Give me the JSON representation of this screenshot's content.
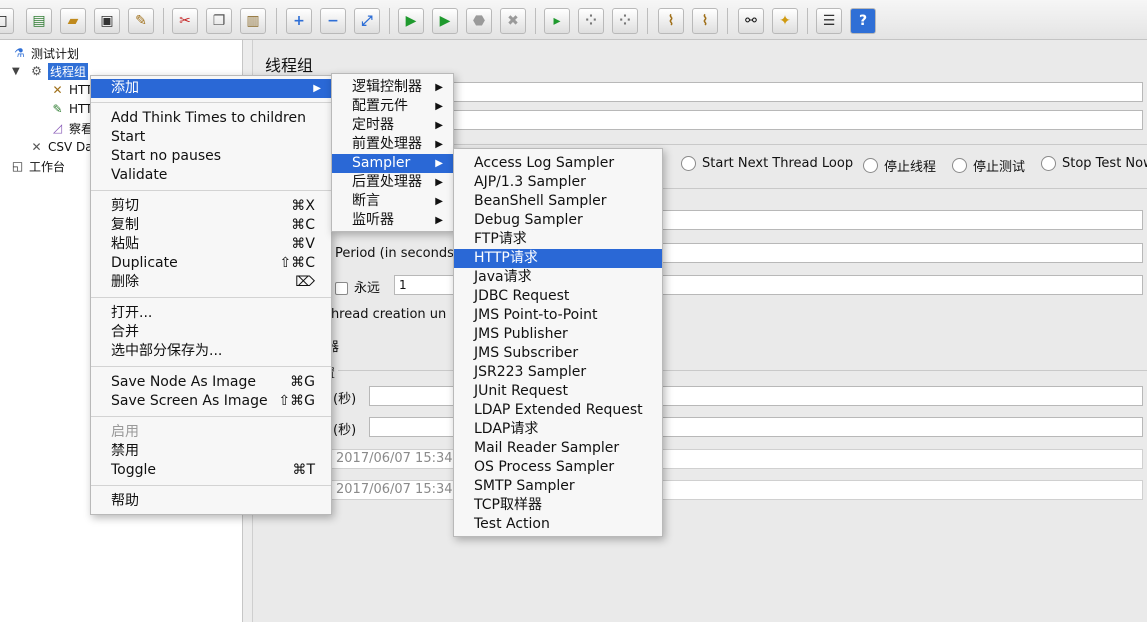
{
  "toolbar": {
    "buttons": [
      "new-icon",
      "templates-icon",
      "open-icon",
      "save-icon",
      "edit-icon",
      "cut-icon",
      "copy-icon",
      "paste-icon",
      "expand-icon",
      "collapse-icon",
      "toggle-icon",
      "start-icon",
      "start-no-pause-icon",
      "stop-icon",
      "shutdown-icon",
      "remote-start-icon",
      "remote-stop-icon",
      "remote-shutdown-icon",
      "clear-icon",
      "clear-all-icon",
      "search-icon",
      "reset-search-icon",
      "function-helper-icon",
      "help-icon"
    ]
  },
  "tree": {
    "items": [
      {
        "label": "测试计划"
      },
      {
        "label": "线程组"
      },
      {
        "label": "HTT"
      },
      {
        "label": "HTT"
      },
      {
        "label": "察看"
      },
      {
        "label": "CSV Da"
      },
      {
        "label": "工作台"
      }
    ]
  },
  "panel": {
    "title": "线程组",
    "radio_start_next_thread_loop": "Start Next Thread Loop",
    "radio_stop_thread": "停止线程",
    "radio_stop_test": "停止测试",
    "radio_stop_test_now": "Stop Test Now",
    "ramp_up_label": "Period (in seconds)",
    "forever_label": "永远",
    "loop_count_value": "1",
    "thread_creation_label": "Thread creation un",
    "scheduler_suffix": "器",
    "scheduler_group_suffix": "置",
    "duration_label": "(秒)",
    "startup_delay_label": "(秒)",
    "start_time_value": "2017/06/07 15:34:",
    "end_time_value": "2017/06/07 15:34:"
  },
  "context_menu": {
    "add": "添加",
    "add_think_times": "Add Think Times to children",
    "start": "Start",
    "start_no_pauses": "Start no pauses",
    "validate": "Validate",
    "cut": "剪切",
    "cut_shortcut": "⌘X",
    "copy": "复制",
    "copy_shortcut": "⌘C",
    "paste": "粘贴",
    "paste_shortcut": "⌘V",
    "duplicate": "Duplicate",
    "duplicate_shortcut": "⇧⌘C",
    "delete": "删除",
    "delete_shortcut": "⌦",
    "open": "打开...",
    "merge": "合并",
    "save_selection_as": "选中部分保存为...",
    "save_node_as_image": "Save Node As Image",
    "save_node_shortcut": "⌘G",
    "save_screen_as_image": "Save Screen As Image",
    "save_screen_shortcut": "⇧⌘G",
    "enable": "启用",
    "disable": "禁用",
    "toggle": "Toggle",
    "toggle_shortcut": "⌘T",
    "help": "帮助"
  },
  "add_submenu": {
    "items": [
      "逻辑控制器",
      "配置元件",
      "定时器",
      "前置处理器",
      "Sampler",
      "后置处理器",
      "断言",
      "监听器"
    ],
    "active": "Sampler"
  },
  "sampler_submenu": {
    "items": [
      "Access Log Sampler",
      "AJP/1.3 Sampler",
      "BeanShell Sampler",
      "Debug Sampler",
      "FTP请求",
      "HTTP请求",
      "Java请求",
      "JDBC Request",
      "JMS Point-to-Point",
      "JMS Publisher",
      "JMS Subscriber",
      "JSR223 Sampler",
      "JUnit Request",
      "LDAP Extended Request",
      "LDAP请求",
      "Mail Reader Sampler",
      "OS Process Sampler",
      "SMTP Sampler",
      "TCP取样器",
      "Test Action"
    ],
    "active": "HTTP请求"
  },
  "colors": {
    "highlight": "#2a68d6",
    "menu_bg": "#f7f7f7"
  }
}
